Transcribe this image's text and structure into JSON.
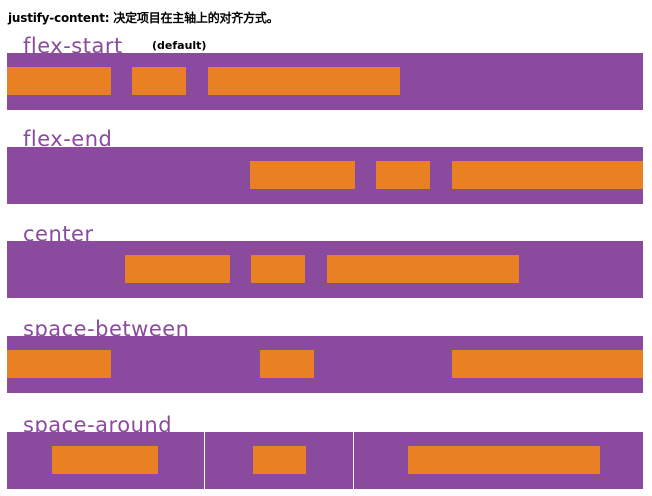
{
  "header": {
    "text": "justify-content: 决定项目在主轴上的对齐方式。"
  },
  "sections": [
    {
      "label": "flex-start",
      "note": "(default)"
    },
    {
      "label": "flex-end"
    },
    {
      "label": "center"
    },
    {
      "label": "space-between"
    },
    {
      "label": "space-around"
    }
  ],
  "colors": {
    "band": "#8a4a9d",
    "item": "#e98124",
    "label": "#8a4a9d"
  }
}
